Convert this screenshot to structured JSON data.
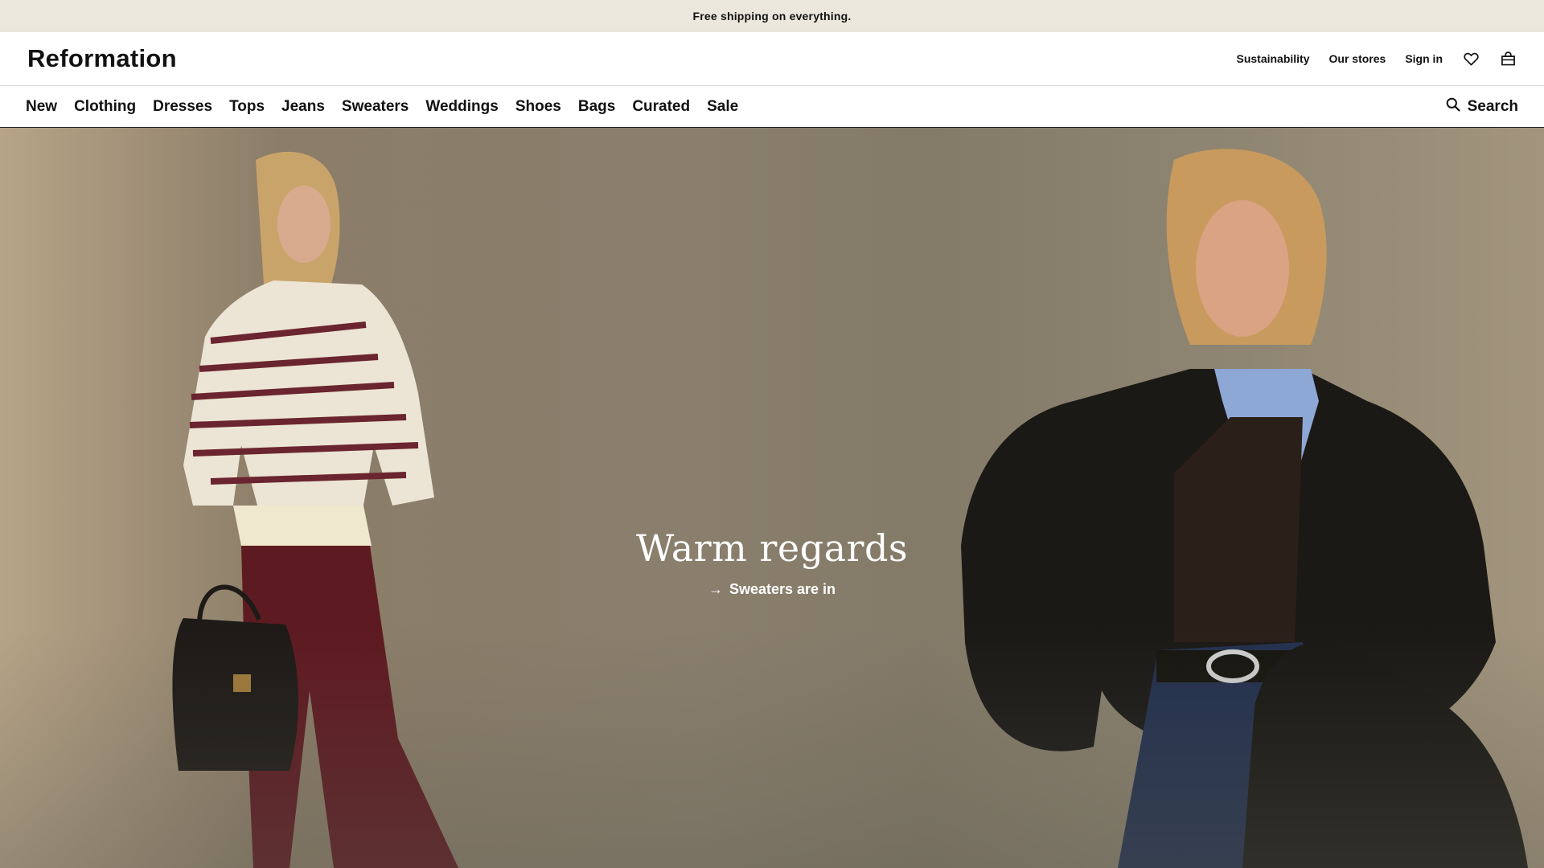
{
  "announcement": "Free shipping on everything.",
  "brand": "Reformation",
  "utility_nav": {
    "sustainability": "Sustainability",
    "stores": "Our stores",
    "sign_in": "Sign in",
    "wishlist_icon": "heart-icon",
    "bag_icon": "shopping-bag-icon"
  },
  "main_nav": [
    "New",
    "Clothing",
    "Dresses",
    "Tops",
    "Jeans",
    "Sweaters",
    "Weddings",
    "Shoes",
    "Bags",
    "Curated",
    "Sale"
  ],
  "search": {
    "label": "Search",
    "icon": "search-icon"
  },
  "hero": {
    "headline": "Warm regards",
    "cta_arrow": "→",
    "cta_label": "Sweaters are in"
  },
  "colors": {
    "announcement_bg": "#ebe7dc",
    "text": "#111111",
    "hero_bg": "#8a7f6d"
  }
}
